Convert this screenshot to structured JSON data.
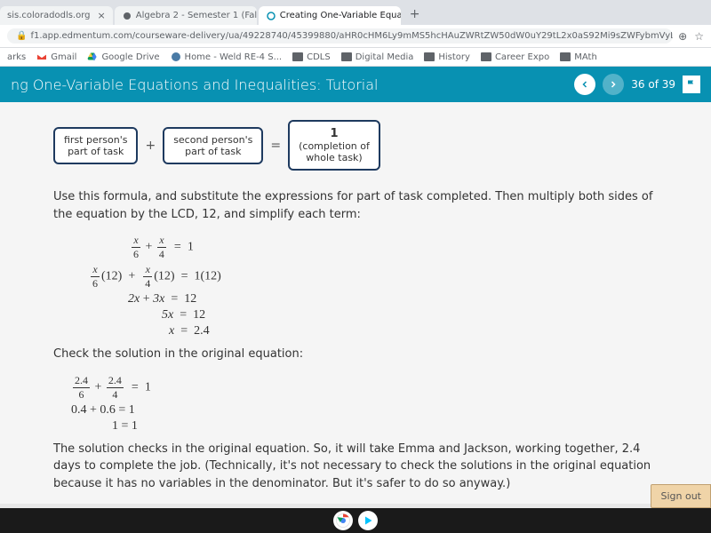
{
  "tabs": [
    {
      "label": "sis.coloradodls.org",
      "active": false
    },
    {
      "label": "Algebra 2 - Semester 1 (Fall 2020",
      "active": false
    },
    {
      "label": "Creating One-Variable Equations",
      "active": true
    }
  ],
  "url": "f1.app.edmentum.com/courseware-delivery/ua/49228740/45399880/aHR0cHM6Ly9mMS5hcHAuZWRtZW50dW0uY29tL2x0aS92Mi9sZWFybmVyL2xlc3Nvbi9wYXRod2F5L2xl...",
  "bookmarks": [
    {
      "label": "arks",
      "icon": "text"
    },
    {
      "label": "Gmail",
      "icon": "gmail"
    },
    {
      "label": "Google Drive",
      "icon": "drive"
    },
    {
      "label": "Home - Weld RE-4 S...",
      "icon": "re4"
    },
    {
      "label": "CDLS",
      "icon": "folder"
    },
    {
      "label": "Digital Media",
      "icon": "folder"
    },
    {
      "label": "History",
      "icon": "folder"
    },
    {
      "label": "Career Expo",
      "icon": "folder"
    },
    {
      "label": "MAth",
      "icon": "folder"
    }
  ],
  "header": {
    "title": "ng One-Variable Equations and Inequalities: Tutorial",
    "progress": "36 of 39"
  },
  "formula": {
    "box1_line1": "first person's",
    "box1_line2": "part of task",
    "box2_line1": "second person's",
    "box2_line2": "part of task",
    "box3_line1": "1",
    "box3_line2": "(completion of",
    "box3_line3": "whole task)"
  },
  "intro_text": "Use this formula, and substitute the expressions for part of task completed. Then multiply both sides of the equation by the LCD, 12, and simplify each term:",
  "check_text": "Check the solution in the original equation:",
  "conclusion": "The solution checks in the original equation. So, it will take Emma and Jackson, working together, 2.4 days to complete the job. (Technically, it's not necessary to check the solutions in the original equation because it has no variables in the denominator. But it's safer to do so anyway.)",
  "signout": "Sign out",
  "math": {
    "l1_n1": "x",
    "l1_d1": "6",
    "l1_n2": "x",
    "l1_d2": "4",
    "l1_rhs": "1",
    "l2_n1": "x",
    "l2_d1": "6",
    "l2_m1": "(12)",
    "l2_n2": "x",
    "l2_d2": "4",
    "l2_m2": "(12)",
    "l2_rhs": "1(12)",
    "l3": "2x + 3x  =  12",
    "l4": "5x  =  12",
    "l5": "x  =  2.4",
    "c1_n1": "2.4",
    "c1_d1": "6",
    "c1_n2": "2.4",
    "c1_d2": "4",
    "c1_rhs": "1",
    "c2": "0.4 + 0.6  =  1",
    "c3": "1  =  1"
  }
}
